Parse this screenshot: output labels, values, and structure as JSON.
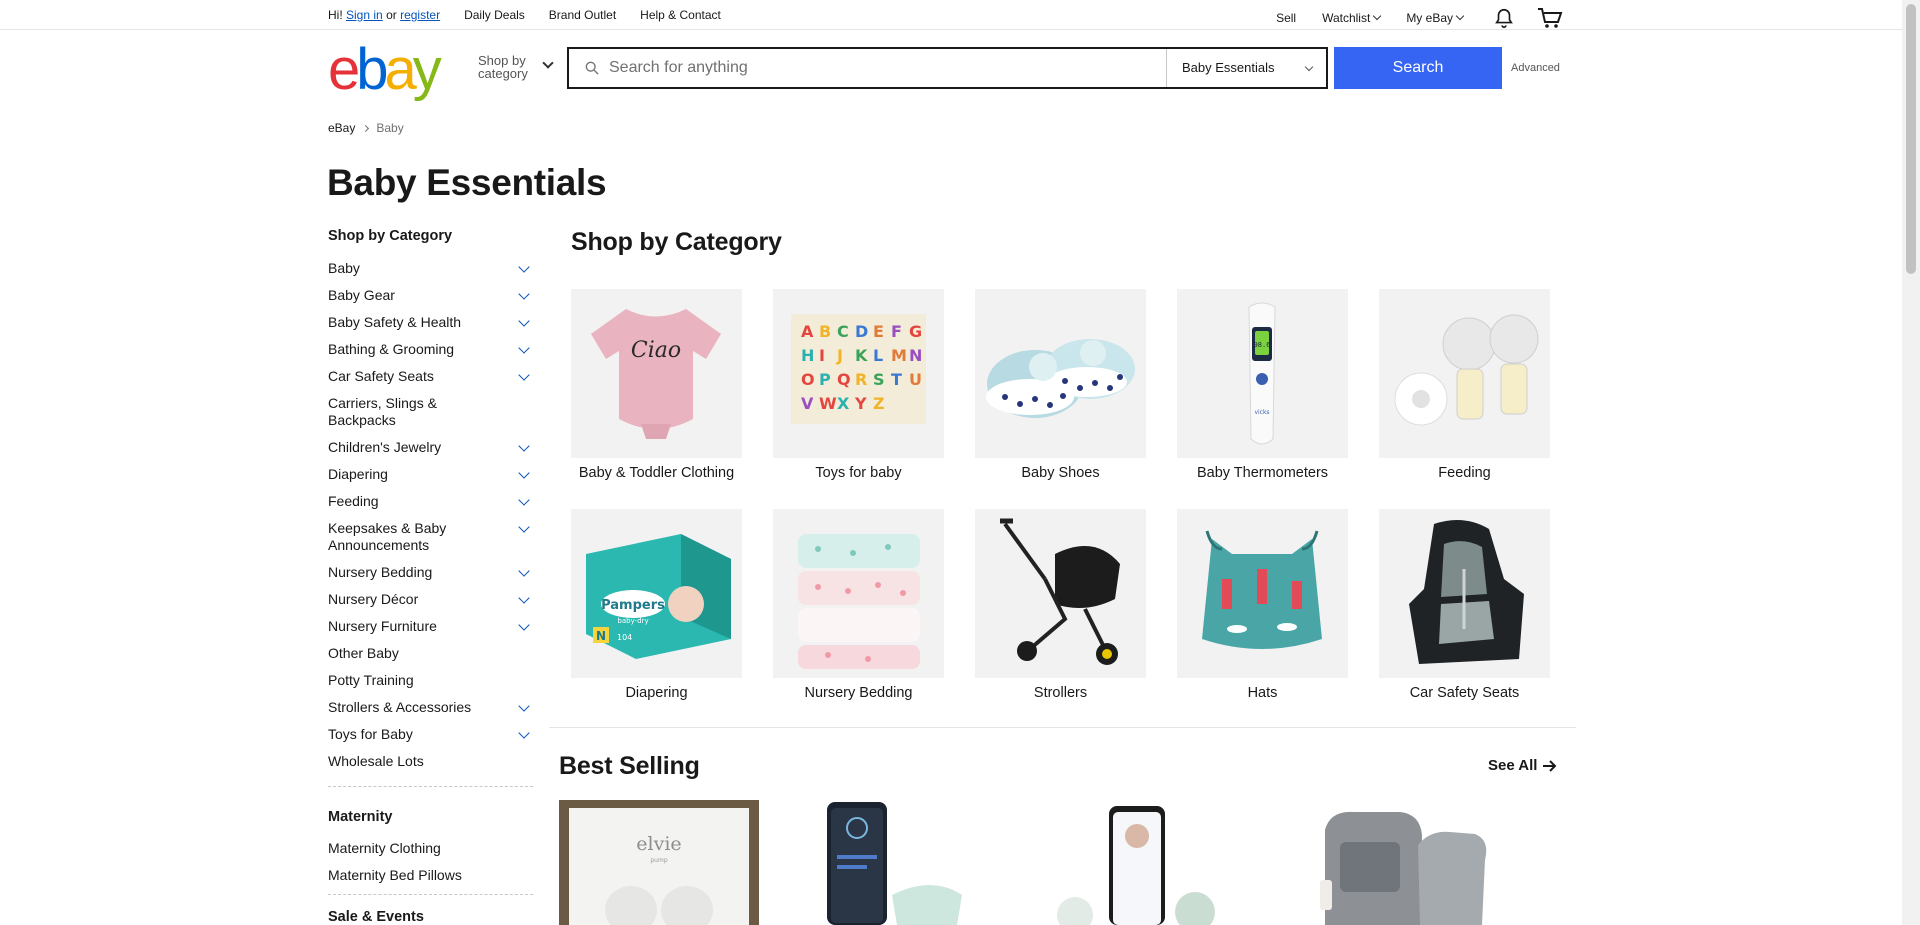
{
  "topbar": {
    "greeting": "Hi!",
    "sign_in": "Sign in",
    "or": "or",
    "register": "register",
    "nav": [
      "Daily Deals",
      "Brand Outlet",
      "Help & Contact"
    ],
    "right": {
      "sell": "Sell",
      "watchlist": "Watchlist",
      "myebay": "My eBay"
    }
  },
  "header": {
    "logo": [
      "e",
      "b",
      "a",
      "y"
    ],
    "shop_by_line1": "Shop by",
    "shop_by_line2": "category",
    "search_placeholder": "Search for anything",
    "search_category": "Baby Essentials",
    "search_button": "Search",
    "advanced": "Advanced"
  },
  "breadcrumb": {
    "root": "eBay",
    "current": "Baby"
  },
  "page_title": "Baby Essentials",
  "sidebar": {
    "heading": "Shop by Category",
    "items": [
      {
        "label": "Baby",
        "expand": true
      },
      {
        "label": "Baby Gear",
        "expand": true
      },
      {
        "label": "Baby Safety & Health",
        "expand": true
      },
      {
        "label": "Bathing & Grooming",
        "expand": true
      },
      {
        "label": "Car Safety Seats",
        "expand": true
      },
      {
        "label": "Carriers, Slings & Backpacks",
        "expand": false
      },
      {
        "label": "Children's Jewelry",
        "expand": true
      },
      {
        "label": "Diapering",
        "expand": true
      },
      {
        "label": "Feeding",
        "expand": true
      },
      {
        "label": "Keepsakes & Baby Announcements",
        "expand": true
      },
      {
        "label": "Nursery Bedding",
        "expand": true
      },
      {
        "label": "Nursery Décor",
        "expand": true
      },
      {
        "label": "Nursery Furniture",
        "expand": true
      },
      {
        "label": "Other Baby",
        "expand": false
      },
      {
        "label": "Potty Training",
        "expand": false
      },
      {
        "label": "Strollers & Accessories",
        "expand": true
      },
      {
        "label": "Toys for Baby",
        "expand": true
      },
      {
        "label": "Wholesale Lots",
        "expand": false
      }
    ],
    "maternity_heading": "Maternity",
    "maternity_items": [
      "Maternity Clothing",
      "Maternity Bed Pillows"
    ],
    "sales_heading": "Sale & Events"
  },
  "main": {
    "heading": "Shop by Category",
    "categories": [
      "Baby & Toddler Clothing",
      "Toys for baby",
      "Baby Shoes",
      "Baby Thermometers",
      "Feeding",
      "Diapering",
      "Nursery Bedding",
      "Strollers",
      "Hats",
      "Car Safety Seats"
    ],
    "onesie_text": "Ciao",
    "thermo_reading": "98.6",
    "thermo_brand": "vicks",
    "diaper_brand": "Pampers",
    "diaper_sub": "baby-dry",
    "diaper_size": "N",
    "diaper_count": "104",
    "alphabet": "ABCDEFGHIJKLMNOPQRSTUVWXYZ"
  },
  "best_selling": {
    "heading": "Best Selling",
    "see_all": "See All",
    "elvie": "elvie",
    "elvie_sub": "pump"
  },
  "icon_names": [
    "search-icon",
    "bell-icon",
    "cart-icon",
    "arrow-right-icon",
    "chevron-down-icon"
  ]
}
